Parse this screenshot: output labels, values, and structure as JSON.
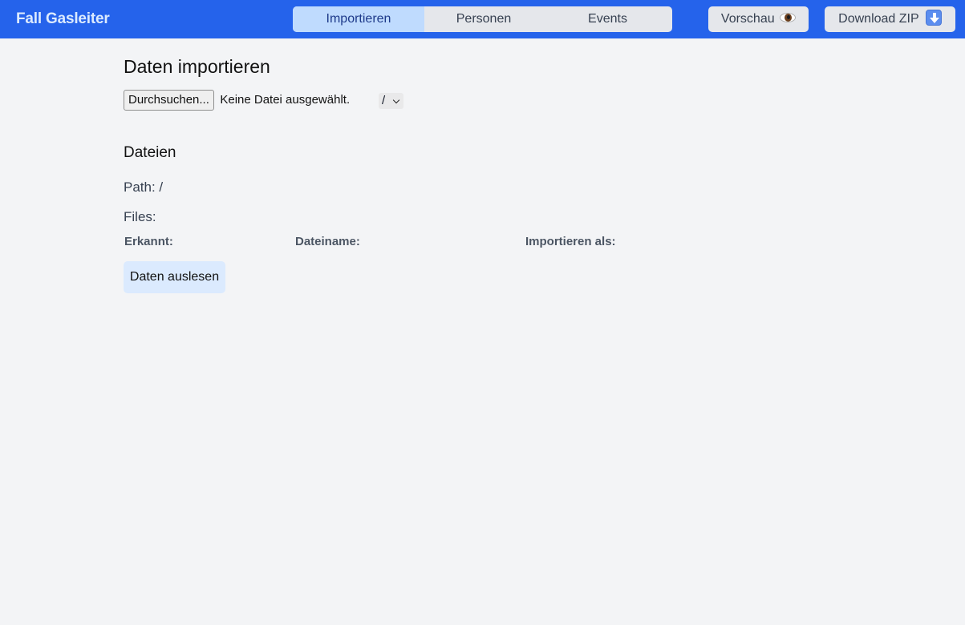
{
  "header": {
    "brand": "Fall Gasleiter",
    "tabs": [
      {
        "label": "Importieren",
        "active": true
      },
      {
        "label": "Personen",
        "active": false
      },
      {
        "label": "Events",
        "active": false
      }
    ],
    "preview_label": "Vorschau",
    "preview_icon": "eye-icon",
    "download_label": "Download ZIP",
    "download_icon": "down-arrow-icon"
  },
  "import": {
    "title": "Daten importieren",
    "browse_label": "Durchsuchen...",
    "file_status": "Keine Datei ausgewählt.",
    "path_select_value": "/"
  },
  "files_section": {
    "title": "Dateien",
    "path_text": "Path: /",
    "files_text": "Files:",
    "columns": [
      "Erkannt:",
      "Dateiname:",
      "Importieren als:"
    ],
    "read_button": "Daten auslesen"
  },
  "colors": {
    "header_bg": "#2563eb",
    "tab_active_bg": "#bfdbfe",
    "button_bg": "#e5e7eb",
    "primary_button_bg": "#dbeafe",
    "page_bg": "#f3f4f6"
  }
}
